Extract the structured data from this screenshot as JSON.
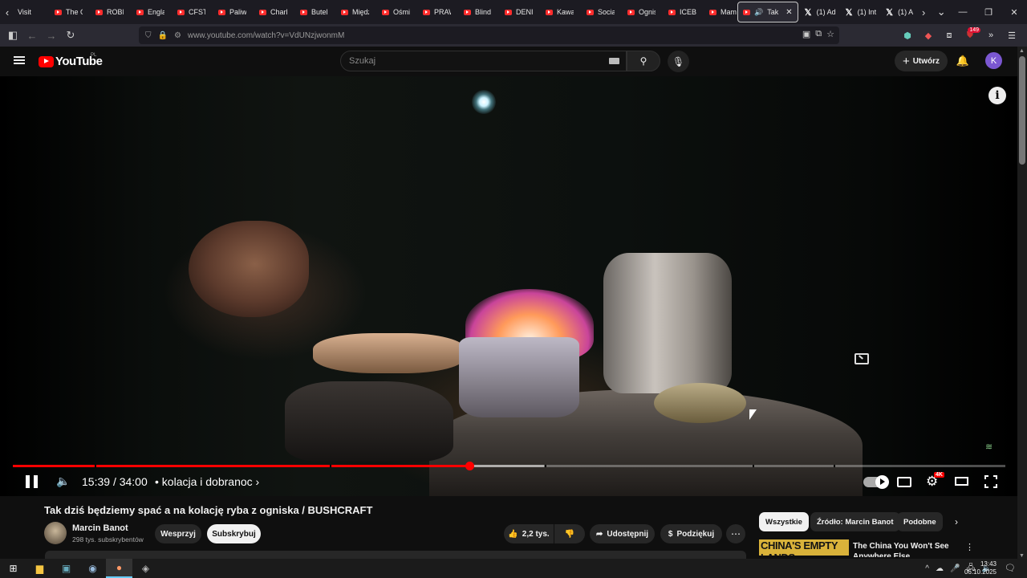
{
  "browser": {
    "tabs": [
      {
        "label": "Visit",
        "type": "plain"
      },
      {
        "label": "The G",
        "type": "youtube"
      },
      {
        "label": "ROBI",
        "type": "youtube"
      },
      {
        "label": "Engla",
        "type": "youtube"
      },
      {
        "label": "CFST",
        "type": "youtube"
      },
      {
        "label": "Paliw",
        "type": "youtube"
      },
      {
        "label": "Charl",
        "type": "youtube"
      },
      {
        "label": "Butel",
        "type": "youtube"
      },
      {
        "label": "Międz",
        "type": "youtube"
      },
      {
        "label": "Ośmi",
        "type": "youtube"
      },
      {
        "label": "PRAW",
        "type": "youtube"
      },
      {
        "label": "Blind",
        "type": "youtube"
      },
      {
        "label": "DENI",
        "type": "youtube"
      },
      {
        "label": "Kawal",
        "type": "youtube"
      },
      {
        "label": "Social",
        "type": "youtube"
      },
      {
        "label": "Ognis",
        "type": "youtube"
      },
      {
        "label": "ICEBE",
        "type": "youtube"
      },
      {
        "label": "Mam",
        "type": "youtube"
      }
    ],
    "active_tab": {
      "label": "Tak",
      "close": "✕"
    },
    "x_tabs": [
      "(1) Ad",
      "(1) Int",
      "(1) A"
    ],
    "url": "www.youtube.com/watch?v=VdUNzjwonmM",
    "extension_badge": "149"
  },
  "youtube": {
    "logo_text": "YouTube",
    "region": "PL",
    "search_placeholder": "Szukaj",
    "create_label": "Utwórz",
    "avatar_letter": "K"
  },
  "player": {
    "current_time": "15:39",
    "duration": "34:00",
    "time_separator": "/",
    "chapter": "• kolacja i dobranoc",
    "chapter_arrow": "›",
    "played_fraction": 0.46,
    "buffered_fraction": 0.535,
    "quality_badge": "4K"
  },
  "video": {
    "title": "Tak dziś będziemy spać a na kolację ryba z ogniska / BUSHCRAFT",
    "channel": "Marcin Banot",
    "subscribers": "298 tys. subskrybentów",
    "support_label": "Wesprzyj",
    "subscribe_label": "Subskrybuj",
    "likes": "2,2 tys.",
    "share_label": "Udostępnij",
    "thanks_label": "Podziękuj"
  },
  "sidebar": {
    "chips": [
      "Wszystkie",
      "Źródło: Marcin Banot",
      "Podobne"
    ],
    "recommendation": {
      "thumb_text": "CHINA'S EMPTY LANDS",
      "title": "The China You Won't See Anywhere Else"
    }
  },
  "taskbar": {
    "time": "13:43",
    "date": "06.10.2025"
  },
  "colors": {
    "accent_red": "#ff0000",
    "background": "#0f0f0f",
    "avatar": "#7b57d1"
  }
}
